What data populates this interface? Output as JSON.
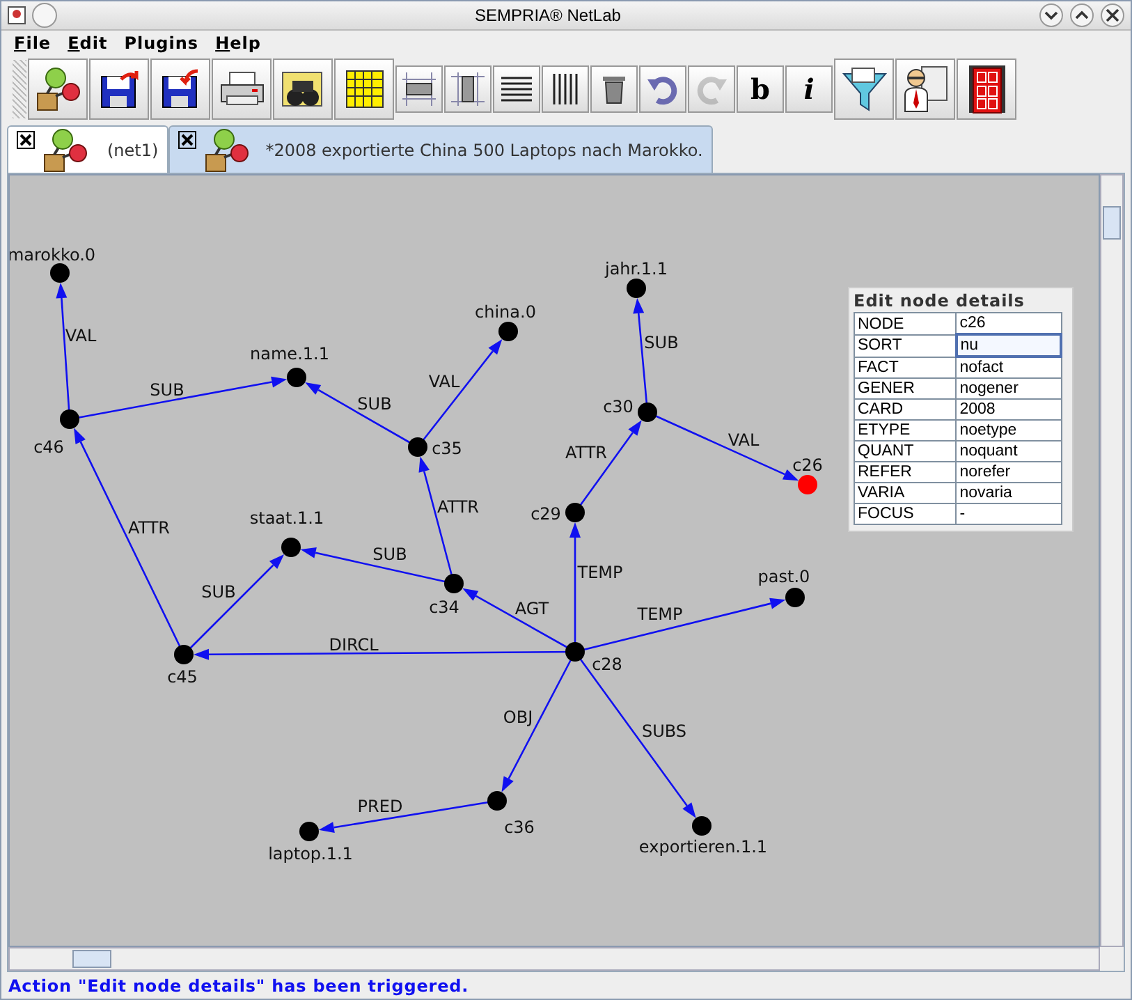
{
  "window": {
    "title": "SEMPRIA® NetLab"
  },
  "menu": [
    {
      "label": "File",
      "underlined": true
    },
    {
      "label": "Edit",
      "underlined": true
    },
    {
      "label": "Plugins",
      "underlined": false
    },
    {
      "label": "Help",
      "underlined": true
    }
  ],
  "toolbar": [
    {
      "kind": "net",
      "disabled": false
    },
    {
      "kind": "save",
      "disabled": false
    },
    {
      "kind": "load",
      "disabled": false
    },
    {
      "kind": "print",
      "disabled": false
    },
    {
      "kind": "find",
      "disabled": false
    },
    {
      "kind": "grid",
      "disabled": false
    },
    {
      "kind": "rows",
      "disabled": false
    },
    {
      "kind": "cols",
      "disabled": false
    },
    {
      "kind": "hlines",
      "disabled": false
    },
    {
      "kind": "vlines",
      "disabled": false
    },
    {
      "kind": "trash",
      "disabled": false
    },
    {
      "kind": "undo",
      "disabled": false
    },
    {
      "kind": "redo",
      "disabled": true
    },
    {
      "kind": "text",
      "label": "b",
      "disabled": false
    },
    {
      "kind": "text",
      "label": "i",
      "disabled": false
    },
    {
      "kind": "filter",
      "disabled": false
    },
    {
      "kind": "presenter",
      "disabled": false
    },
    {
      "kind": "exit",
      "disabled": false
    }
  ],
  "tabs": [
    {
      "label": "(net1)",
      "selected": false
    },
    {
      "label": "*2008 exportierte China 500 Laptops nach Marokko.",
      "selected": true
    }
  ],
  "graph": {
    "nodes": [
      {
        "label": "marokko.0",
        "selected": false
      },
      {
        "label": "name.1.1",
        "selected": false
      },
      {
        "label": "china.0",
        "selected": false
      },
      {
        "label": "jahr.1.1",
        "selected": false
      },
      {
        "label": "c46",
        "selected": false
      },
      {
        "label": "c35",
        "selected": false
      },
      {
        "label": "c30",
        "selected": false
      },
      {
        "label": "c26",
        "selected": true
      },
      {
        "label": "c29",
        "selected": false
      },
      {
        "label": "staat.1.1",
        "selected": false
      },
      {
        "label": "c34",
        "selected": false
      },
      {
        "label": "past.0",
        "selected": false
      },
      {
        "label": "c45",
        "selected": false
      },
      {
        "label": "c28",
        "selected": false
      },
      {
        "label": "c36",
        "selected": false
      },
      {
        "label": "laptop.1.1",
        "selected": false
      },
      {
        "label": "exportieren.1.1",
        "selected": false
      }
    ],
    "edges": [
      {
        "label": "VAL"
      },
      {
        "label": "SUB"
      },
      {
        "label": "SUB"
      },
      {
        "label": "VAL"
      },
      {
        "label": "SUB"
      },
      {
        "label": "VAL"
      },
      {
        "label": "ATTR"
      },
      {
        "label": "TEMP"
      },
      {
        "label": "ATTR"
      },
      {
        "label": "SUB"
      },
      {
        "label": "AGT"
      },
      {
        "label": "TEMP"
      },
      {
        "label": "DIRCL"
      },
      {
        "label": "ATTR"
      },
      {
        "label": "SUB"
      },
      {
        "label": "OBJ"
      },
      {
        "label": "SUBS"
      },
      {
        "label": "PRED"
      }
    ]
  },
  "details": {
    "title": "Edit node details",
    "rows": [
      {
        "key": "NODE",
        "value": "c26",
        "focused": false
      },
      {
        "key": "SORT",
        "value": "nu",
        "focused": true
      },
      {
        "key": "FACT",
        "value": "nofact",
        "focused": false
      },
      {
        "key": "GENER",
        "value": "nogener",
        "focused": false
      },
      {
        "key": "CARD",
        "value": "2008",
        "focused": false
      },
      {
        "key": "ETYPE",
        "value": "noetype",
        "focused": false
      },
      {
        "key": "QUANT",
        "value": "noquant",
        "focused": false
      },
      {
        "key": "REFER",
        "value": "norefer",
        "focused": false
      },
      {
        "key": "VARIA",
        "value": "novaria",
        "focused": false
      },
      {
        "key": "FOCUS",
        "value": "-",
        "focused": false
      }
    ]
  },
  "status_bar": "Action \"Edit node details\" has been triggered."
}
